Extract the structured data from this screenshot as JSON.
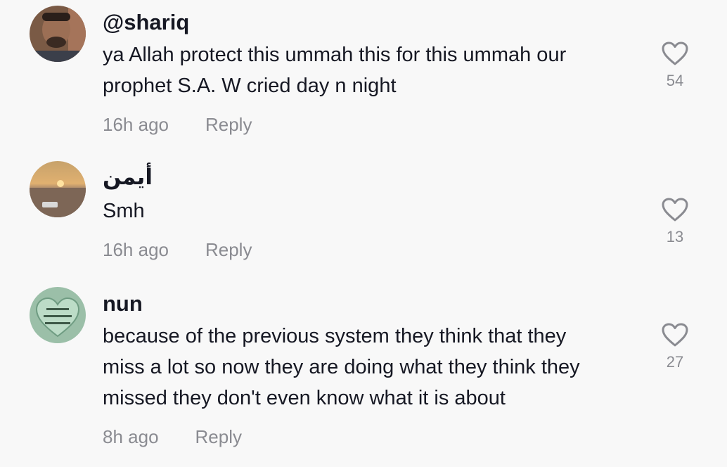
{
  "comments": [
    {
      "username": "@shariq",
      "lines": [
        "ya Allah protect this ummah this for this ummah our",
        "prophet S.A. W cried day n night"
      ],
      "time": "16h ago",
      "reply_label": "Reply",
      "likes": "54"
    },
    {
      "username": "أيمن",
      "lines": [
        "Smh"
      ],
      "time": "16h ago",
      "reply_label": "Reply",
      "likes": "13"
    },
    {
      "username": "nun",
      "lines": [
        "because of the previous system they think that they",
        "miss a lot so now they are doing what they think they",
        "missed they don't even know what it is about"
      ],
      "time": "8h ago",
      "reply_label": "Reply",
      "likes": "27"
    }
  ],
  "icons": {
    "like": "heart-outline-icon"
  },
  "colors": {
    "background": "#f8f8f8",
    "primary_text": "#161823",
    "secondary_text": "#8a8b91"
  }
}
